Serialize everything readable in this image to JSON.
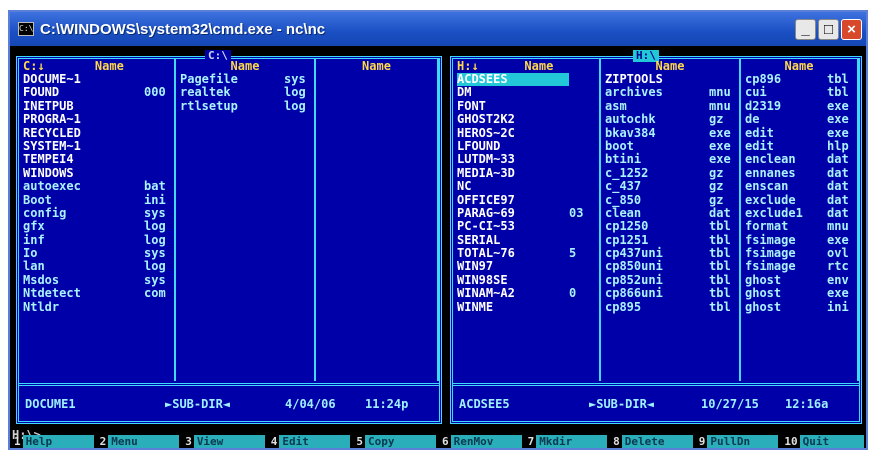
{
  "window": {
    "title": "C:\\WINDOWS\\system32\\cmd.exe - nc\\nc",
    "icon_label": "C:\\",
    "buttons": {
      "minimize": "_",
      "maximize": "□",
      "close": "×"
    }
  },
  "left_panel": {
    "path": "C:\\",
    "drive_label": "C:↓",
    "col_headers": [
      "Name",
      "Name",
      "Name"
    ],
    "col1": [
      {
        "name": "DOCUME~1",
        "ext": "",
        "dir": true
      },
      {
        "name": "FOUND",
        "ext": "000",
        "dir": true
      },
      {
        "name": "INETPUB",
        "ext": "",
        "dir": true
      },
      {
        "name": "PROGRA~1",
        "ext": "",
        "dir": true
      },
      {
        "name": "RECYCLED",
        "ext": "",
        "dir": true
      },
      {
        "name": "SYSTEM~1",
        "ext": "",
        "dir": true
      },
      {
        "name": "TEMPEI4",
        "ext": "",
        "dir": true
      },
      {
        "name": "WINDOWS",
        "ext": "",
        "dir": true
      },
      {
        "name": "autoexec",
        "ext": "bat",
        "dir": false
      },
      {
        "name": "Boot",
        "ext": "ini",
        "dir": false
      },
      {
        "name": "config",
        "ext": "sys",
        "dir": false
      },
      {
        "name": "gfx",
        "ext": "log",
        "dir": false
      },
      {
        "name": "inf",
        "ext": "log",
        "dir": false
      },
      {
        "name": "Io",
        "ext": "sys",
        "dir": false
      },
      {
        "name": "lan",
        "ext": "log",
        "dir": false
      },
      {
        "name": "Msdos",
        "ext": "sys",
        "dir": false
      },
      {
        "name": "Ntdetect",
        "ext": "com",
        "dir": false
      },
      {
        "name": "Ntldr",
        "ext": "",
        "dir": false
      }
    ],
    "col2": [
      {
        "name": "Pagefile",
        "ext": "sys",
        "dir": false
      },
      {
        "name": "realtek",
        "ext": "log",
        "dir": false
      },
      {
        "name": "rtlsetup",
        "ext": "log",
        "dir": false
      }
    ],
    "col3": [],
    "status": {
      "name": "DOCUME1",
      "type": "►SUB-DIR◄",
      "date": "4/04/06",
      "time": "11:24p"
    }
  },
  "right_panel": {
    "path": "H:\\",
    "drive_label": "H:↓",
    "col_headers": [
      "Name",
      "Name",
      "Name"
    ],
    "col1": [
      {
        "name": "ACDSEES",
        "ext": "",
        "dir": true,
        "selected": true
      },
      {
        "name": "DM",
        "ext": "",
        "dir": true
      },
      {
        "name": "FONT",
        "ext": "",
        "dir": true
      },
      {
        "name": "GHOST2K2",
        "ext": "",
        "dir": true
      },
      {
        "name": "HEROS~2C",
        "ext": "",
        "dir": true
      },
      {
        "name": "LFOUND",
        "ext": "",
        "dir": true
      },
      {
        "name": "LUTDM~33",
        "ext": "",
        "dir": true
      },
      {
        "name": "MEDIA~3D",
        "ext": "",
        "dir": true
      },
      {
        "name": "NC",
        "ext": "",
        "dir": true
      },
      {
        "name": "OFFICE97",
        "ext": "",
        "dir": true
      },
      {
        "name": "PARAG~69",
        "ext": "03",
        "dir": true
      },
      {
        "name": "PC-CI~53",
        "ext": "",
        "dir": true
      },
      {
        "name": "SERIAL",
        "ext": "",
        "dir": true
      },
      {
        "name": "TOTAL~76",
        "ext": "5",
        "dir": true
      },
      {
        "name": "WIN97",
        "ext": "",
        "dir": true
      },
      {
        "name": "WIN98SE",
        "ext": "",
        "dir": true
      },
      {
        "name": "WINAM~A2",
        "ext": "0",
        "dir": true
      },
      {
        "name": "WINME",
        "ext": "",
        "dir": true
      }
    ],
    "col2": [
      {
        "name": "ZIPTOOLS",
        "ext": "",
        "dir": true
      },
      {
        "name": "archives",
        "ext": "mnu",
        "dir": false
      },
      {
        "name": "asm",
        "ext": "mnu",
        "dir": false
      },
      {
        "name": "autochk",
        "ext": "gz",
        "dir": false
      },
      {
        "name": "bkav384",
        "ext": "exe",
        "dir": false
      },
      {
        "name": "boot",
        "ext": "exe",
        "dir": false
      },
      {
        "name": "btini",
        "ext": "exe",
        "dir": false
      },
      {
        "name": "c_1252",
        "ext": "gz",
        "dir": false
      },
      {
        "name": "c_437",
        "ext": "gz",
        "dir": false
      },
      {
        "name": "c_850",
        "ext": "gz",
        "dir": false
      },
      {
        "name": "clean",
        "ext": "dat",
        "dir": false
      },
      {
        "name": "cp1250",
        "ext": "tbl",
        "dir": false
      },
      {
        "name": "cp1251",
        "ext": "tbl",
        "dir": false
      },
      {
        "name": "cp437uni",
        "ext": "tbl",
        "dir": false
      },
      {
        "name": "cp850uni",
        "ext": "tbl",
        "dir": false
      },
      {
        "name": "cp852uni",
        "ext": "tbl",
        "dir": false
      },
      {
        "name": "cp866uni",
        "ext": "tbl",
        "dir": false
      },
      {
        "name": "cp895",
        "ext": "tbl",
        "dir": false
      }
    ],
    "col3": [
      {
        "name": "cp896",
        "ext": "tbl",
        "dir": false
      },
      {
        "name": "cui",
        "ext": "tbl",
        "dir": false
      },
      {
        "name": "d2319",
        "ext": "exe",
        "dir": false
      },
      {
        "name": "de",
        "ext": "exe",
        "dir": false
      },
      {
        "name": "edit",
        "ext": "exe",
        "dir": false
      },
      {
        "name": "edit",
        "ext": "hlp",
        "dir": false
      },
      {
        "name": "enclean",
        "ext": "dat",
        "dir": false
      },
      {
        "name": "ennanes",
        "ext": "dat",
        "dir": false
      },
      {
        "name": "enscan",
        "ext": "dat",
        "dir": false
      },
      {
        "name": "exclude",
        "ext": "dat",
        "dir": false
      },
      {
        "name": "exclude1",
        "ext": "dat",
        "dir": false
      },
      {
        "name": "format",
        "ext": "mnu",
        "dir": false
      },
      {
        "name": "fsimage",
        "ext": "exe",
        "dir": false
      },
      {
        "name": "fsimage",
        "ext": "ovl",
        "dir": false
      },
      {
        "name": "fsimage",
        "ext": "rtc",
        "dir": false
      },
      {
        "name": "ghost",
        "ext": "env",
        "dir": false
      },
      {
        "name": "ghost",
        "ext": "exe",
        "dir": false
      },
      {
        "name": "ghost",
        "ext": "ini",
        "dir": false
      }
    ],
    "status": {
      "name": "ACDSEE5",
      "type": "►SUB-DIR◄",
      "date": "10/27/15",
      "time": "12:16a"
    }
  },
  "prompt": "H:\\>",
  "fkeys": [
    {
      "num": "1",
      "label": "Help"
    },
    {
      "num": "2",
      "label": "Menu"
    },
    {
      "num": "3",
      "label": "View"
    },
    {
      "num": "4",
      "label": "Edit"
    },
    {
      "num": "5",
      "label": "Copy"
    },
    {
      "num": "6",
      "label": "RenMov"
    },
    {
      "num": "7",
      "label": "Mkdir"
    },
    {
      "num": "8",
      "label": "Delete"
    },
    {
      "num": "9",
      "label": "PullDn"
    },
    {
      "num": "10",
      "label": "Quit"
    }
  ]
}
